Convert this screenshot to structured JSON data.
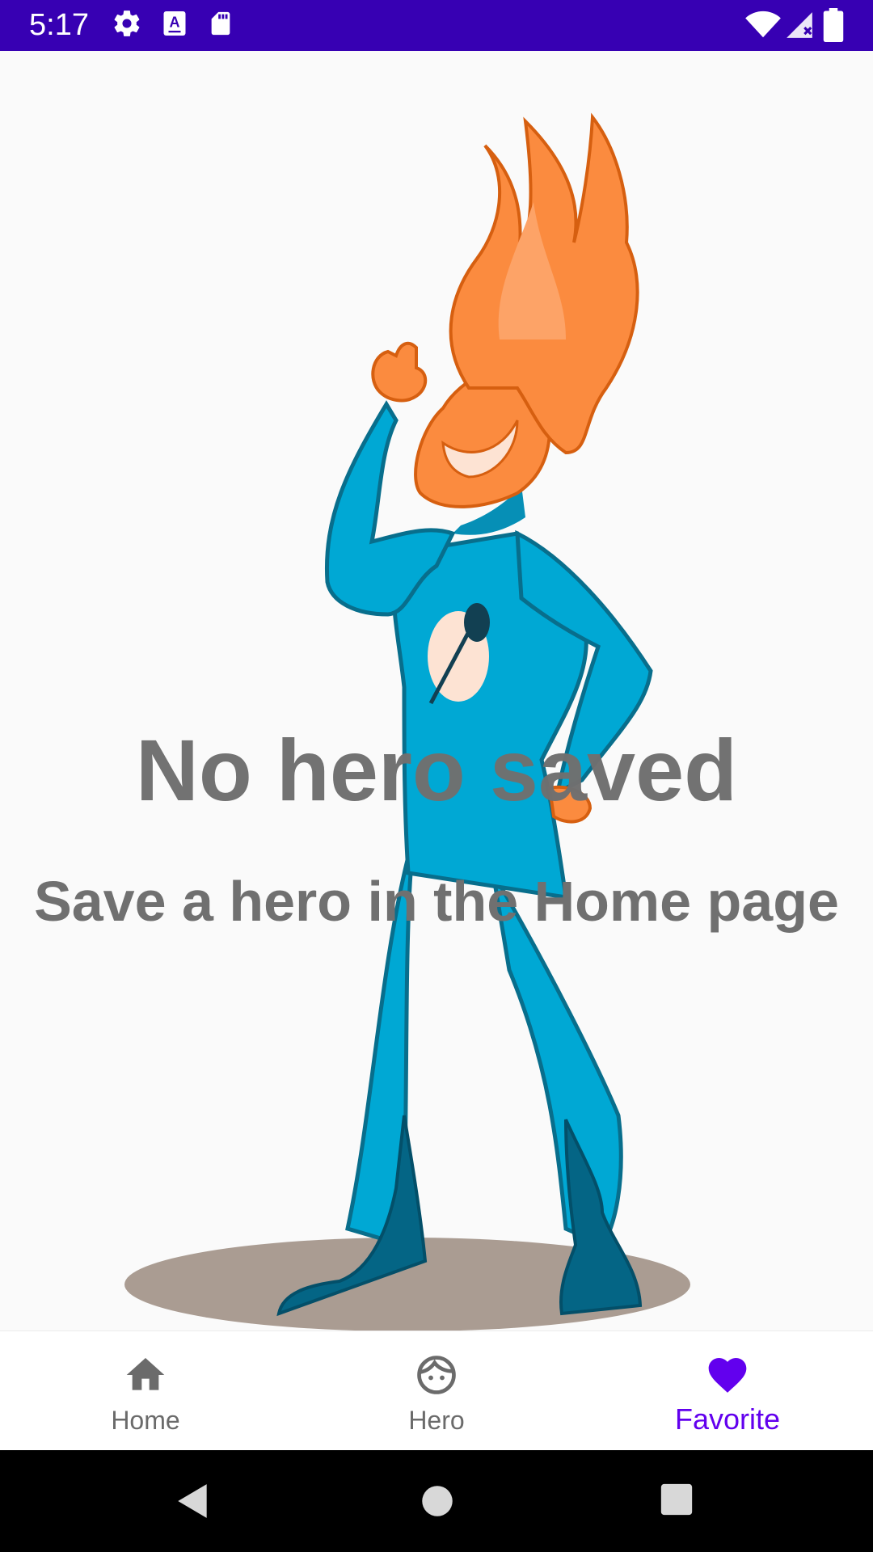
{
  "status_bar": {
    "time": "5:17",
    "background_color": "#3700b3",
    "left_icons": [
      "settings-gear-icon",
      "text-a-icon",
      "sd-card-icon"
    ],
    "right_icons": [
      "wifi-icon",
      "cell-signal-icon",
      "battery-icon"
    ]
  },
  "empty_state": {
    "title": "No hero saved",
    "subtitle": "Save a hero in the Home page",
    "text_color": "#707070",
    "illustration": "flame-haired-superhero"
  },
  "bottom_nav": {
    "items": [
      {
        "label": "Home",
        "icon": "home-icon",
        "active": false
      },
      {
        "label": "Hero",
        "icon": "face-icon",
        "active": false
      },
      {
        "label": "Favorite",
        "icon": "heart-icon",
        "active": true
      }
    ],
    "active_color": "#6200ee",
    "inactive_color": "#6b6b6b"
  },
  "system_nav": {
    "buttons": [
      "back-icon",
      "home-circle-icon",
      "recents-icon"
    ]
  }
}
